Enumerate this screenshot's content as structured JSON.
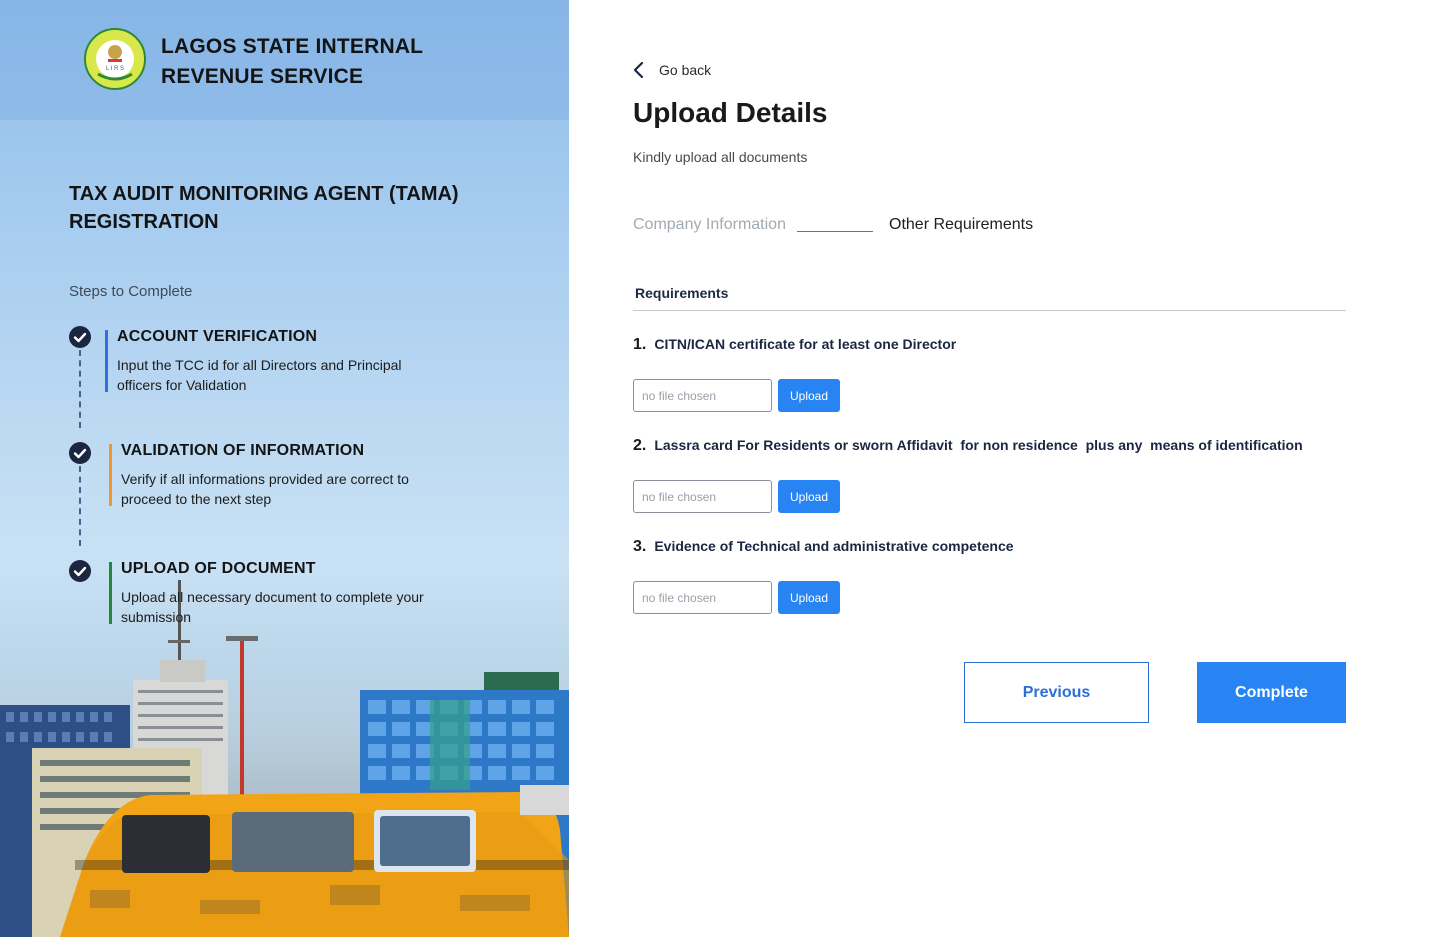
{
  "brand": {
    "line1": "LAGOS STATE INTERNAL",
    "line2": "REVENUE SERVICE",
    "logo_icon": "lirs-seal-logo",
    "logo_text": "INTERNAL REVENUE SERVICE · LIRS · LAGOS STATE"
  },
  "left": {
    "title_line1": "TAX AUDIT MONITORING AGENT (TAMA)",
    "title_line2": "REGISTRATION",
    "steps_label": "Steps to Complete",
    "steps": [
      {
        "title": "ACCOUNT VERIFICATION",
        "desc": "Input the TCC id for all Directors and Principal officers for Validation",
        "color": "#2f6fe0",
        "icon": "check-circle-icon"
      },
      {
        "title": "VALIDATION OF INFORMATION",
        "desc": "Verify if all informations provided are correct to proceed to the next step",
        "color": "#f0962a",
        "icon": "check-circle-icon"
      },
      {
        "title": "UPLOAD OF DOCUMENT",
        "desc": "Upload all necessary document to complete your submission",
        "color": "#1f8a3a",
        "icon": "check-circle-icon"
      }
    ]
  },
  "nav": {
    "back_label": "Go back",
    "back_icon": "chevron-left-icon"
  },
  "main": {
    "title": "Upload Details",
    "subtitle": "Kindly upload all documents",
    "tabs": [
      {
        "label": "Company Information",
        "active": false
      },
      {
        "label": "Other Requirements",
        "active": true
      }
    ],
    "requirements_heading": "Requirements",
    "requirements": [
      {
        "number": "1.",
        "text": "CITN/ICAN certificate for at least one Director",
        "placeholder": "no file chosen",
        "button": "Upload"
      },
      {
        "number": "2.",
        "text": "Lassra card For Residents or sworn Affidavit  for non residence  plus any  means of identification",
        "placeholder": "no file chosen",
        "button": "Upload"
      },
      {
        "number": "3.",
        "text": "Evidence of Technical and administrative competence",
        "placeholder": "no file chosen",
        "button": "Upload"
      }
    ],
    "previous_label": "Previous",
    "complete_label": "Complete"
  },
  "colors": {
    "primary": "#2784f2",
    "dark": "#1b2741",
    "muted": "#a3aab3"
  }
}
